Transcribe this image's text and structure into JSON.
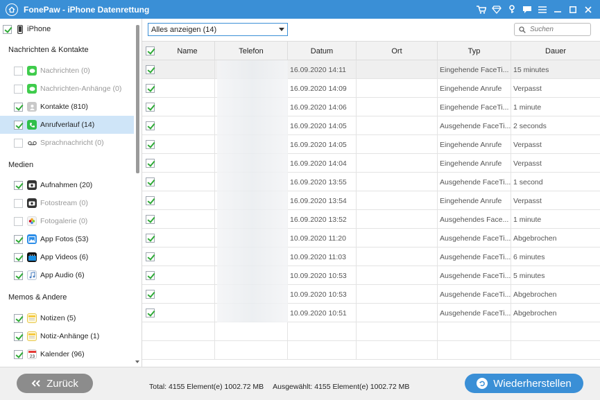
{
  "window": {
    "title": "FonePaw - iPhone Datenrettung",
    "icons": [
      "cart-icon",
      "diamond-icon",
      "key-icon",
      "chat-icon",
      "menu-icon",
      "minimize-icon",
      "maximize-icon",
      "close-icon"
    ]
  },
  "sidebar": {
    "device": "iPhone",
    "sections": [
      {
        "title": "Nachrichten & Kontakte",
        "items": [
          {
            "label": "Nachrichten (0)",
            "icon": "messages-icon",
            "checked": false,
            "disabled": true
          },
          {
            "label": "Nachrichten-Anhänge (0)",
            "icon": "messages-icon",
            "checked": false,
            "disabled": true
          },
          {
            "label": "Kontakte (810)",
            "icon": "contacts-icon",
            "checked": true,
            "disabled": false
          },
          {
            "label": "Anrufverlauf (14)",
            "icon": "phone-icon",
            "checked": true,
            "disabled": false,
            "selected": true
          },
          {
            "label": "Sprachnachricht (0)",
            "icon": "voicemail-icon",
            "checked": false,
            "disabled": true
          }
        ]
      },
      {
        "title": "Medien",
        "items": [
          {
            "label": "Aufnahmen (20)",
            "icon": "camera-icon",
            "checked": true,
            "disabled": false
          },
          {
            "label": "Fotostream (0)",
            "icon": "camera-icon",
            "checked": false,
            "disabled": true
          },
          {
            "label": "Fotogalerie (0)",
            "icon": "photos-icon",
            "checked": false,
            "disabled": true
          },
          {
            "label": "App Fotos (53)",
            "icon": "app-photos-icon",
            "checked": true,
            "disabled": false
          },
          {
            "label": "App Videos (6)",
            "icon": "video-icon",
            "checked": true,
            "disabled": false
          },
          {
            "label": "App Audio (6)",
            "icon": "music-icon",
            "checked": true,
            "disabled": false
          }
        ]
      },
      {
        "title": "Memos & Andere",
        "items": [
          {
            "label": "Notizen (5)",
            "icon": "notes-icon",
            "checked": true,
            "disabled": false
          },
          {
            "label": "Notiz-Anhänge (1)",
            "icon": "notes-icon",
            "checked": true,
            "disabled": false
          },
          {
            "label": "Kalender (96)",
            "icon": "calendar-icon",
            "checked": true,
            "disabled": false
          }
        ]
      }
    ]
  },
  "main": {
    "filter": "Alles anzeigen (14)",
    "search_placeholder": "Suchen",
    "columns": [
      "Name",
      "Telefon",
      "Datum",
      "Ort",
      "Typ",
      "Dauer"
    ],
    "rows": [
      {
        "name": "",
        "phone": "",
        "date": "16.09.2020 14:11",
        "place": "",
        "type": "Eingehende FaceTi...",
        "duration": "15 minutes"
      },
      {
        "name": "",
        "phone": "",
        "date": "16.09.2020 14:09",
        "place": "",
        "type": "Eingehende Anrufe",
        "duration": "Verpasst"
      },
      {
        "name": "",
        "phone": "",
        "date": "16.09.2020 14:06",
        "place": "",
        "type": "Eingehende FaceTi...",
        "duration": "1 minute"
      },
      {
        "name": "",
        "phone": "",
        "date": "16.09.2020 14:05",
        "place": "",
        "type": "Ausgehende FaceTi...",
        "duration": "2 seconds"
      },
      {
        "name": "",
        "phone": "",
        "date": "16.09.2020 14:05",
        "place": "",
        "type": "Eingehende Anrufe",
        "duration": "Verpasst"
      },
      {
        "name": "",
        "phone": "",
        "date": "16.09.2020 14:04",
        "place": "",
        "type": "Eingehende Anrufe",
        "duration": "Verpasst"
      },
      {
        "name": "",
        "phone": "",
        "date": "16.09.2020 13:55",
        "place": "",
        "type": "Ausgehende FaceTi...",
        "duration": "1 second"
      },
      {
        "name": "",
        "phone": "",
        "date": "16.09.2020 13:54",
        "place": "",
        "type": "Eingehende Anrufe",
        "duration": "Verpasst"
      },
      {
        "name": "",
        "phone": "",
        "date": "16.09.2020 13:52",
        "place": "",
        "type": "Ausgehendes Face...",
        "duration": "1 minute"
      },
      {
        "name": "",
        "phone": "",
        "date": "10.09.2020 11:20",
        "place": "",
        "type": "Ausgehende FaceTi...",
        "duration": "Abgebrochen"
      },
      {
        "name": "",
        "phone": "",
        "date": "10.09.2020 11:03",
        "place": "",
        "type": "Ausgehende FaceTi...",
        "duration": "6 minutes"
      },
      {
        "name": "",
        "phone": "",
        "date": "10.09.2020 10:53",
        "place": "",
        "type": "Ausgehende FaceTi...",
        "duration": "5 minutes"
      },
      {
        "name": "",
        "phone": "",
        "date": "10.09.2020 10:53",
        "place": "",
        "type": "Ausgehende FaceTi...",
        "duration": "Abgebrochen"
      },
      {
        "name": "",
        "phone": "",
        "date": "10.09.2020 10:51",
        "place": "",
        "type": "Ausgehende FaceTi...",
        "duration": "Abgebrochen"
      }
    ]
  },
  "footer": {
    "back_label": "Zurück",
    "total": "Total: 4155 Element(e) 1002.72 MB",
    "selected": "Ausgewählt: 4155 Element(e) 1002.72 MB",
    "restore_label": "Wiederherstellen"
  },
  "colors": {
    "accent": "#3a8fd6",
    "check": "#2eaa36",
    "selected_bg": "#cfe5f8",
    "back_button": "#8c8c8c"
  }
}
